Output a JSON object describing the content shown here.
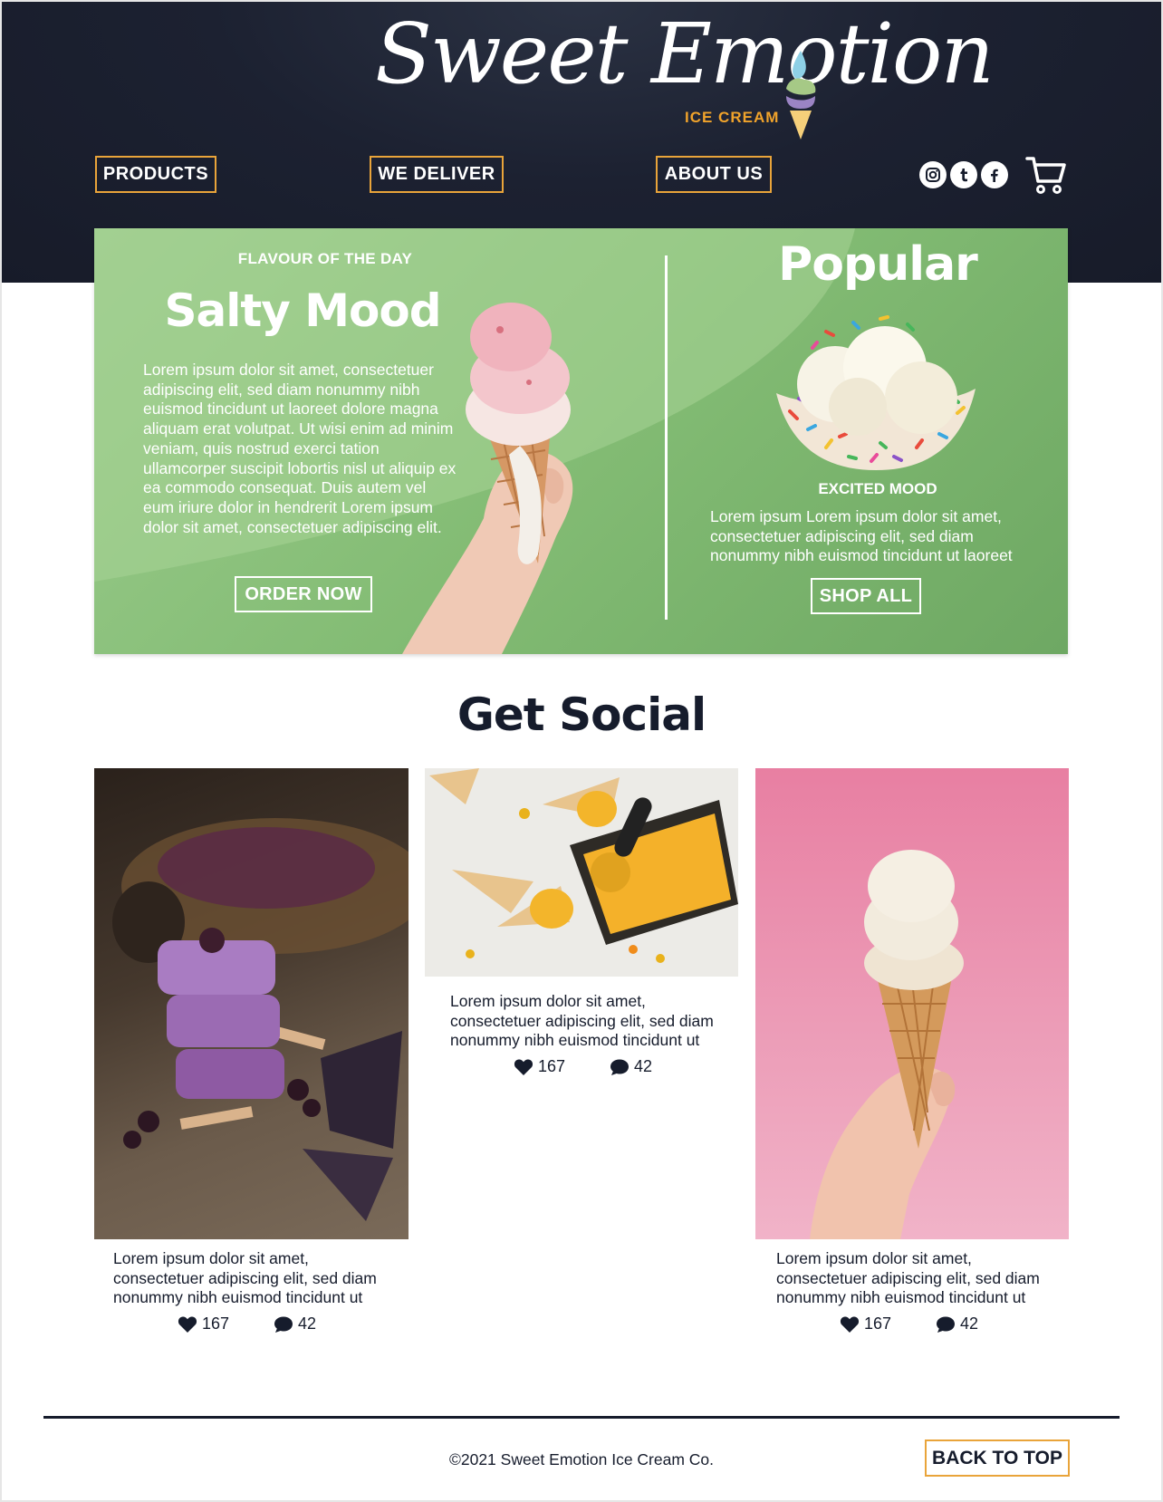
{
  "brand": {
    "name": "Sweet Emotion",
    "tagline": "ICE CREAM",
    "accent": "#e9a43a",
    "dark": "#161c2c",
    "green": "#83bc74"
  },
  "nav": {
    "products": "PRODUCTS",
    "deliver": "WE DELIVER",
    "about": "ABOUT US"
  },
  "social_icons": [
    "instagram-icon",
    "tumblr-icon",
    "facebook-icon",
    "cart-icon"
  ],
  "hero": {
    "kicker": "FLAVOUR OF THE DAY",
    "title": "Salty Mood",
    "body": "Lorem ipsum dolor sit amet, consectetuer adipiscing elit, sed diam nonummy nibh euismod tincidunt ut laoreet dolore magna aliquam erat volutpat. Ut wisi enim ad minim veniam, quis nostrud exerci tation ullamcorper suscipit lobortis nisl ut aliquip ex ea commodo consequat. Duis autem vel eum iriure dolor in hendrerit  Lorem ipsum dolor sit amet, consectetuer adipiscing elit.",
    "cta": "ORDER NOW"
  },
  "popular": {
    "title": "Popular",
    "item": "EXCITED MOOD",
    "body": "Lorem ipsum Lorem ipsum dolor sit amet, consectetuer adipiscing elit, sed diam nonummy nibh euismod tincidunt ut laoreet",
    "cta": "SHOP ALL"
  },
  "social": {
    "title": "Get Social",
    "posts": [
      {
        "text": "Lorem ipsum dolor sit amet, consectetuer adipiscing elit, sed diam nonummy nibh euismod tincidunt ut",
        "likes": "167",
        "comments": "42"
      },
      {
        "text": "Lorem ipsum dolor sit amet, consectetuer adipiscing elit, sed diam nonummy nibh euismod tincidunt ut",
        "likes": "167",
        "comments": "42"
      },
      {
        "text": "Lorem ipsum dolor sit amet, consectetuer adipiscing elit, sed diam nonummy nibh euismod tincidunt ut",
        "likes": "167",
        "comments": "42"
      }
    ]
  },
  "footer": {
    "copyright": "©2021 Sweet Emotion Ice Cream Co.",
    "back_to_top": "BACK TO TOP"
  }
}
